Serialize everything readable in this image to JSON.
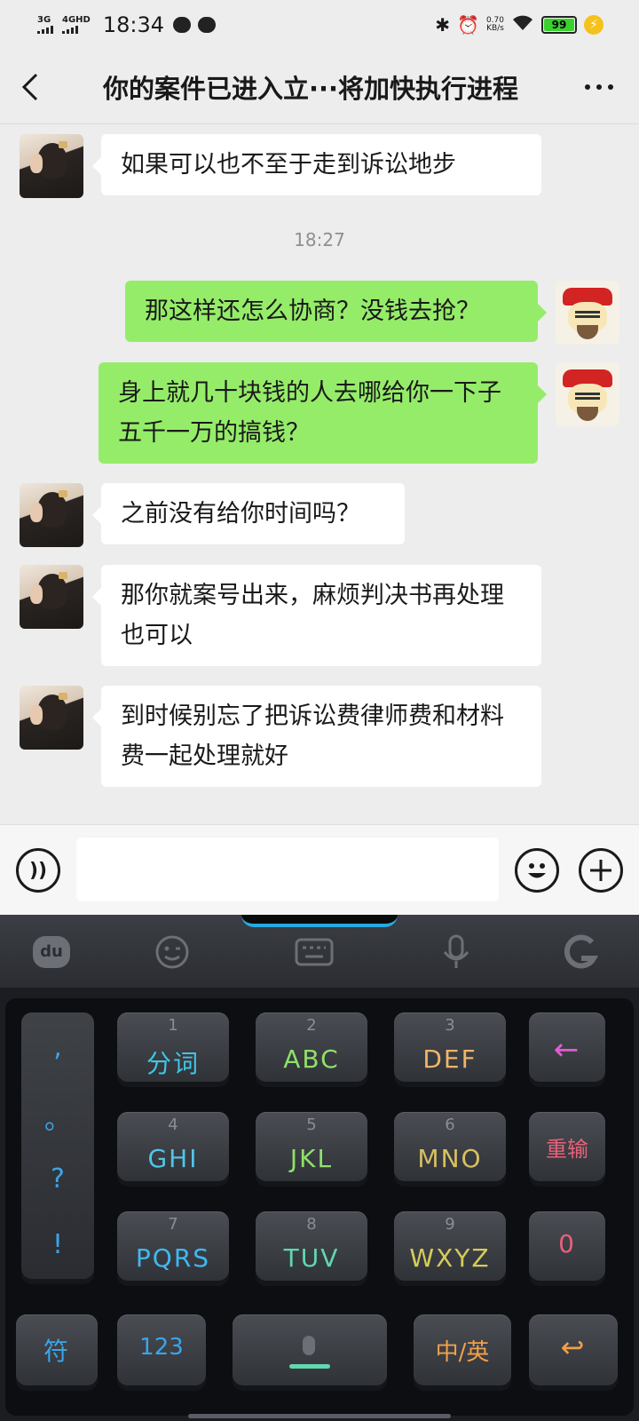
{
  "status_bar": {
    "signal1_label": "3G",
    "signal2_label": "4GHD",
    "time": "18:34",
    "speed_value": "0.70",
    "speed_unit": "KB/s",
    "battery": "99"
  },
  "header": {
    "title": "你的案件已进入立···将加快执行进程"
  },
  "messages": [
    {
      "side": "in",
      "text": "如果可以也不至于走到诉讼地步"
    },
    {
      "side": "out",
      "text": "那这样还怎么协商？没钱去抢？"
    },
    {
      "side": "out",
      "text": "身上就几十块钱的人去哪给你一下子五千一万的搞钱？"
    },
    {
      "side": "in",
      "text": "之前没有给你时间吗？"
    },
    {
      "side": "in",
      "text": "那你就案号出来，麻烦判决书再处理也可以"
    },
    {
      "side": "in",
      "text": "到时候别忘了把诉讼费律师费和材料费一起处理就好"
    }
  ],
  "timestamp": "18:27",
  "input": {
    "placeholder": ""
  },
  "keyboard": {
    "toolbar_logo": "du",
    "punctuation": [
      ",",
      "。",
      "?",
      "!"
    ],
    "keys": [
      {
        "num": "1",
        "label": "分词",
        "color": "#3ec8e6"
      },
      {
        "num": "2",
        "label": "ABC",
        "color": "#8fe06a"
      },
      {
        "num": "3",
        "label": "DEF",
        "color": "#f0b46a"
      },
      {
        "num": "",
        "label": "←",
        "color": "#e45bd4"
      },
      {
        "num": "4",
        "label": "GHI",
        "color": "#4ec6e8"
      },
      {
        "num": "5",
        "label": "JKL",
        "color": "#8fe06a"
      },
      {
        "num": "6",
        "label": "MNO",
        "color": "#d6c062"
      },
      {
        "num": "",
        "label": "重输",
        "color": "#e8607a"
      },
      {
        "num": "7",
        "label": "PQRS",
        "color": "#3fb8f0"
      },
      {
        "num": "8",
        "label": "TUV",
        "color": "#5fd8b0"
      },
      {
        "num": "9",
        "label": "WXYZ",
        "color": "#d6cc5a"
      },
      {
        "num": "",
        "label": "0",
        "color": "#e8607a"
      }
    ],
    "bottom_keys": [
      {
        "label": "符",
        "color": "#3aa5e8"
      },
      {
        "label": "123",
        "color": "#3aa5e8"
      },
      {
        "label": "",
        "color": "#5fd8b0"
      },
      {
        "label": "中/英",
        "color": "#f0a04a"
      },
      {
        "label": "↩",
        "color": "#f0a04a"
      }
    ]
  }
}
